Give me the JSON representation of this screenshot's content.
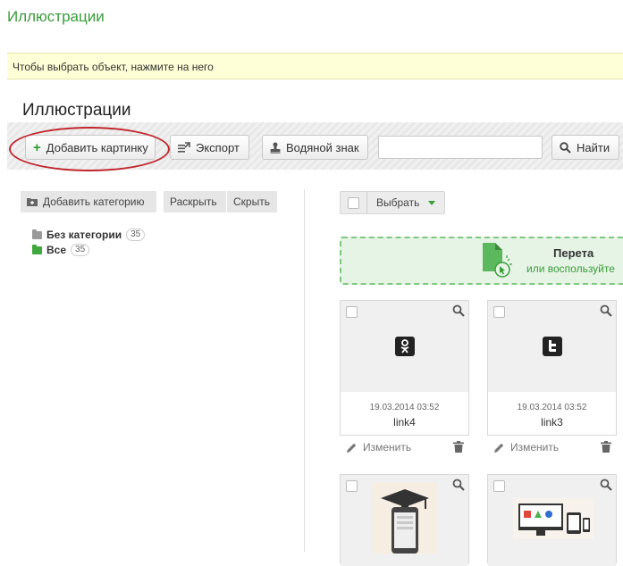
{
  "app": {
    "title": "Иллюстрации"
  },
  "hint": {
    "text": "Чтобы выбрать объект, нажмите на него"
  },
  "page": {
    "title": "Иллюстрации"
  },
  "toolbar": {
    "add_image": "Добавить картинку",
    "export": "Экспорт",
    "watermark": "Водяной знак",
    "search_value": "",
    "search_button": "Найти"
  },
  "categories": {
    "add": "Добавить категорию",
    "expand": "Раскрыть",
    "collapse": "Скрыть",
    "items": [
      {
        "label": "Без категории",
        "count": "35",
        "color": "#999999"
      },
      {
        "label": "Все",
        "count": "35",
        "color": "#3fa83f"
      }
    ]
  },
  "gallery": {
    "select_label": "Выбрать",
    "drop_title": "Перета",
    "drop_subtitle": "или воспользуйте",
    "cards": [
      {
        "date": "19.03.2014 03:52",
        "name": "link4",
        "edit": "Изменить",
        "icon": "odnoklassniki-icon"
      },
      {
        "date": "19.03.2014 03:52",
        "name": "link3",
        "edit": "Изменить",
        "icon": "twitter-icon"
      },
      {
        "date": "",
        "name": "",
        "edit": "",
        "icon": "graduation-phone-icon"
      },
      {
        "date": "",
        "name": "",
        "edit": "",
        "icon": "devices-icon"
      }
    ]
  },
  "colors": {
    "accent": "#3a9c3a",
    "highlight": "#c0272d",
    "hint_bg": "#ffffd7"
  }
}
